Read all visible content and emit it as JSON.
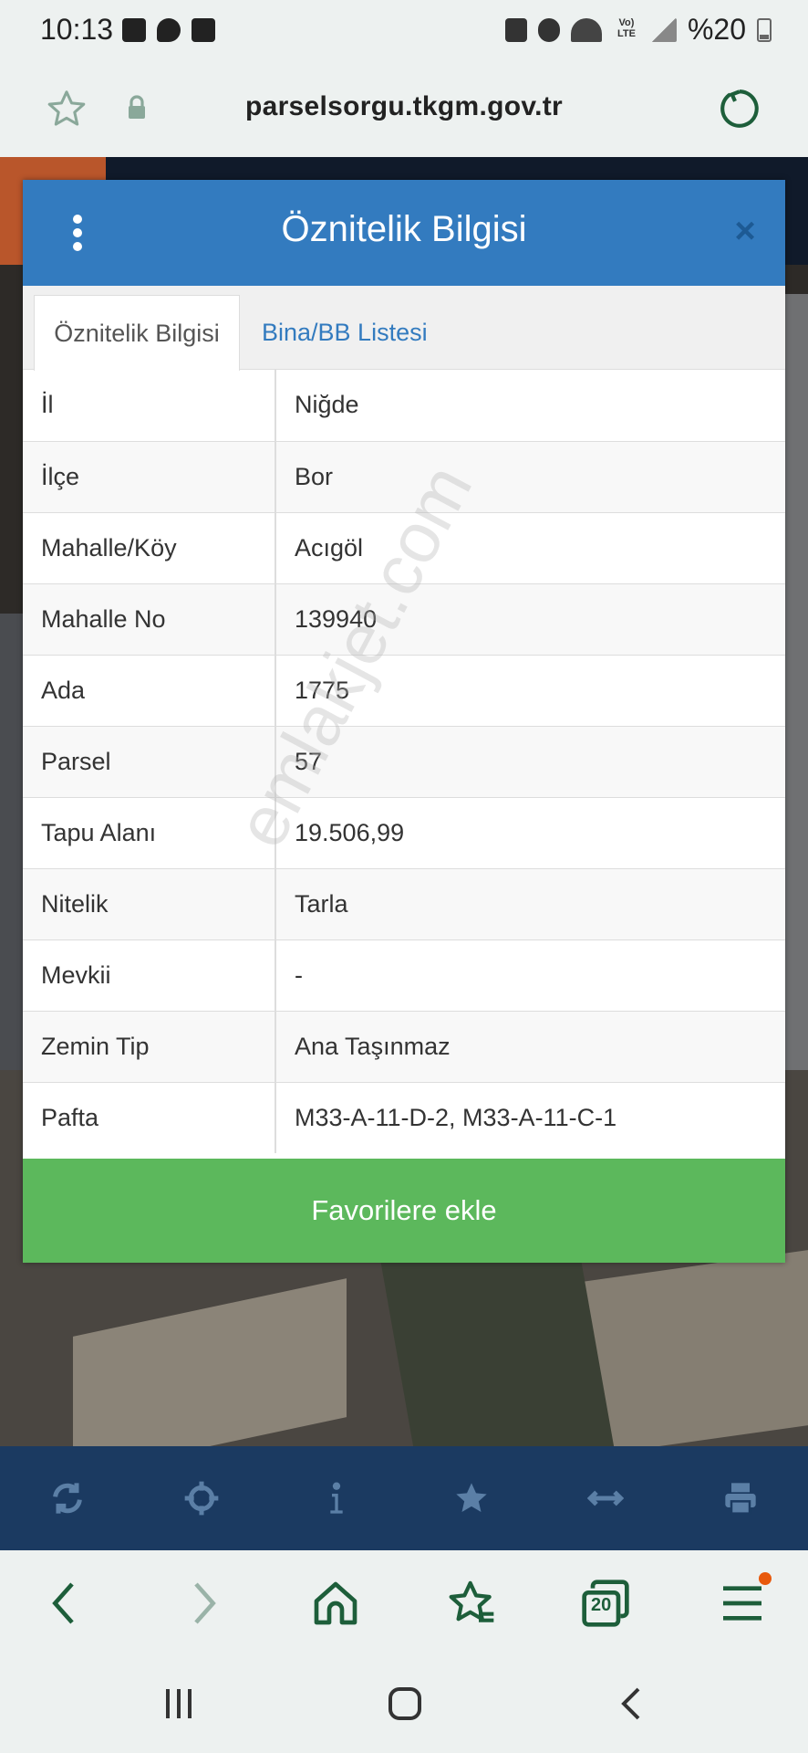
{
  "status_bar": {
    "time": "10:13",
    "battery": "%20",
    "volte_label": "Vo)\nLTE"
  },
  "browser": {
    "url": "parselsorgu.tkgm.gov.tr",
    "tab_count": "20"
  },
  "modal": {
    "title": "Öznitelik Bilgisi",
    "close_label": "×",
    "tabs": [
      {
        "label": "Öznitelik Bilgisi",
        "active": true
      },
      {
        "label": "Bina/BB Listesi",
        "active": false
      }
    ],
    "rows": [
      {
        "key": "İl",
        "value": "Niğde"
      },
      {
        "key": "İlçe",
        "value": "Bor"
      },
      {
        "key": "Mahalle/Köy",
        "value": "Acıgöl"
      },
      {
        "key": "Mahalle No",
        "value": "139940"
      },
      {
        "key": "Ada",
        "value": "1775"
      },
      {
        "key": "Parsel",
        "value": "57"
      },
      {
        "key": "Tapu Alanı",
        "value": "19.506,99"
      },
      {
        "key": "Nitelik",
        "value": "Tarla"
      },
      {
        "key": "Mevkii",
        "value": "-"
      },
      {
        "key": "Zemin Tip",
        "value": "Ana Taşınmaz"
      },
      {
        "key": "Pafta",
        "value": "M33-A-11-D-2, M33-A-11-C-1"
      }
    ],
    "favorite_button": "Favorilere ekle"
  },
  "watermark": "emlakjet.com",
  "map_toolbar": [
    "refresh-icon",
    "locate-icon",
    "info-icon",
    "star-icon",
    "measure-icon",
    "print-icon"
  ],
  "colors": {
    "header_blue": "#337bbf",
    "button_green": "#5cb85c",
    "toolbar_navy": "#1b3a61",
    "browser_green": "#1d5e3a"
  }
}
